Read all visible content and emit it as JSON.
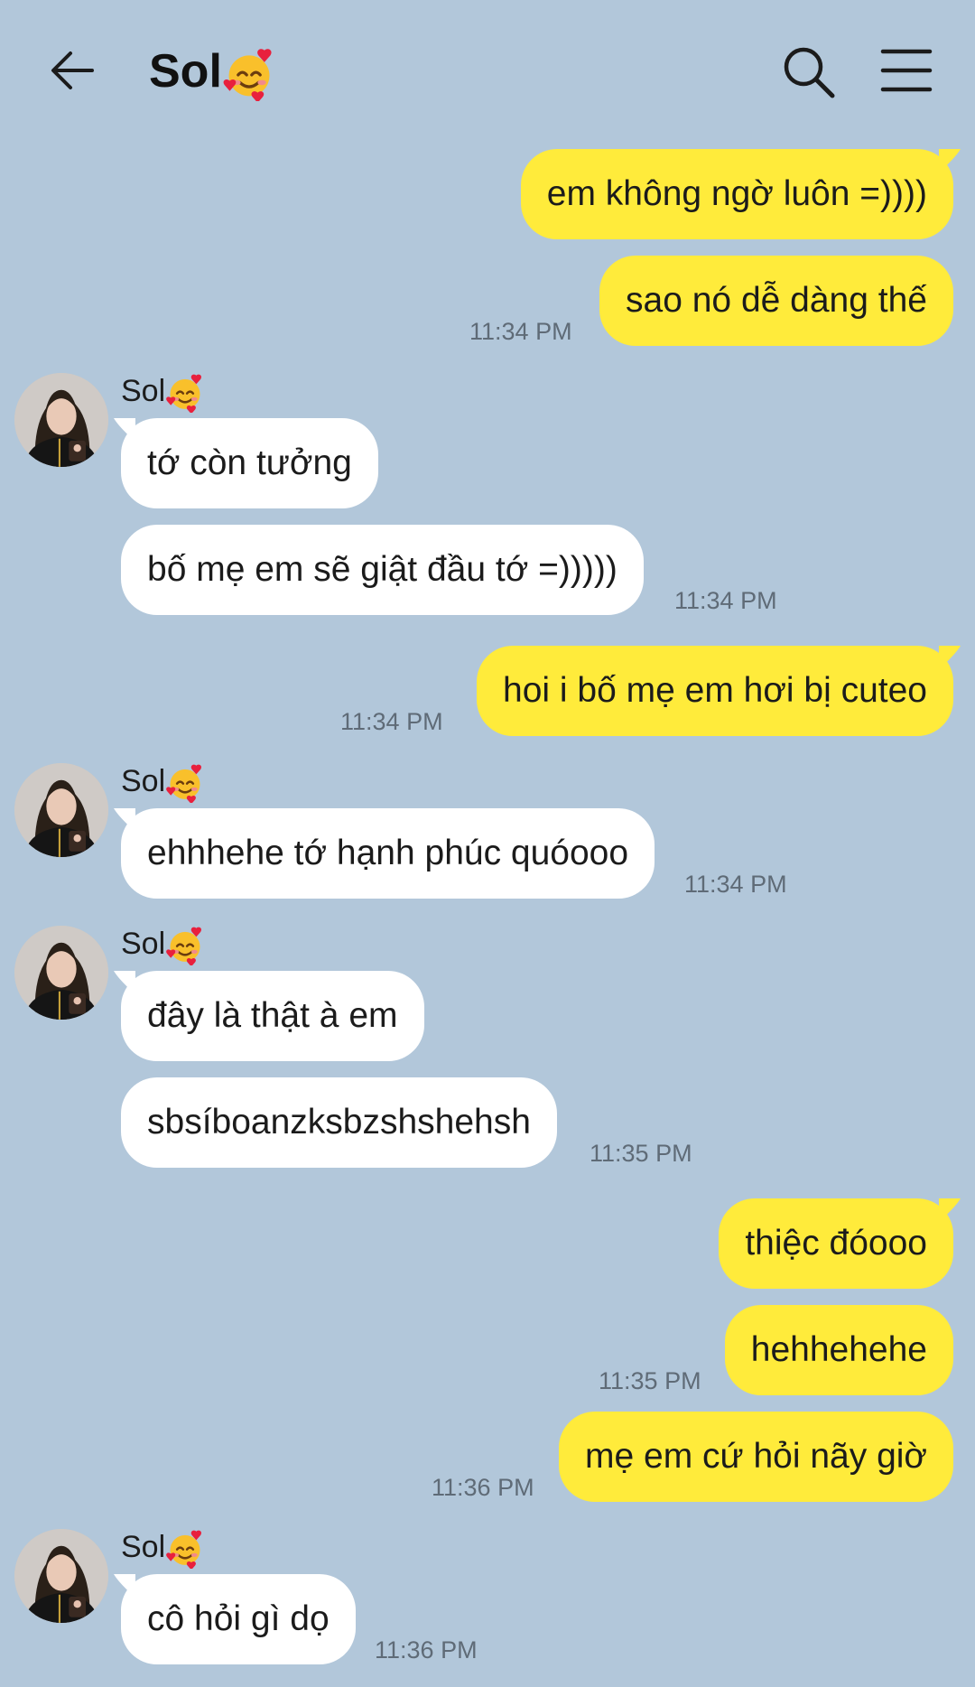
{
  "header": {
    "title": "Sol",
    "title_emoji": "smiling-face-with-hearts-icon"
  },
  "contact": {
    "name": "Sol",
    "name_emoji": "smiling-face-with-hearts-icon"
  },
  "colors": {
    "background": "#b2c7da",
    "my_bubble": "#ffeb3b",
    "their_bubble": "#ffffff",
    "timestamp": "#5f6b77"
  },
  "messages": [
    {
      "sender": "me",
      "text": "em không ngờ luôn =))))"
    },
    {
      "sender": "me",
      "text": "sao nó dễ dàng thế",
      "time": "11:34 PM"
    },
    {
      "sender": "them",
      "text": "tớ còn tưởng"
    },
    {
      "sender": "them",
      "text": "bố mẹ em sẽ giật đầu tớ =)))))",
      "time": "11:34 PM"
    },
    {
      "sender": "me",
      "text": "hoi i bố mẹ em hơi bị cuteo",
      "time": "11:34 PM"
    },
    {
      "sender": "them",
      "text": "ehhhehe tớ hạnh phúc quóooo",
      "time": "11:34 PM"
    },
    {
      "sender": "them",
      "text": "đây là thật à em"
    },
    {
      "sender": "them",
      "text": "sbsíboanzksbzshshehsh",
      "time": "11:35 PM"
    },
    {
      "sender": "me",
      "text": "thiệc đóooo"
    },
    {
      "sender": "me",
      "text": "hehhehehe",
      "time": "11:35 PM"
    },
    {
      "sender": "me",
      "text": "mẹ em cứ hỏi nãy giờ",
      "time": "11:36 PM"
    },
    {
      "sender": "them",
      "text": "cô hỏi gì dọ",
      "time": "11:36 PM"
    }
  ]
}
